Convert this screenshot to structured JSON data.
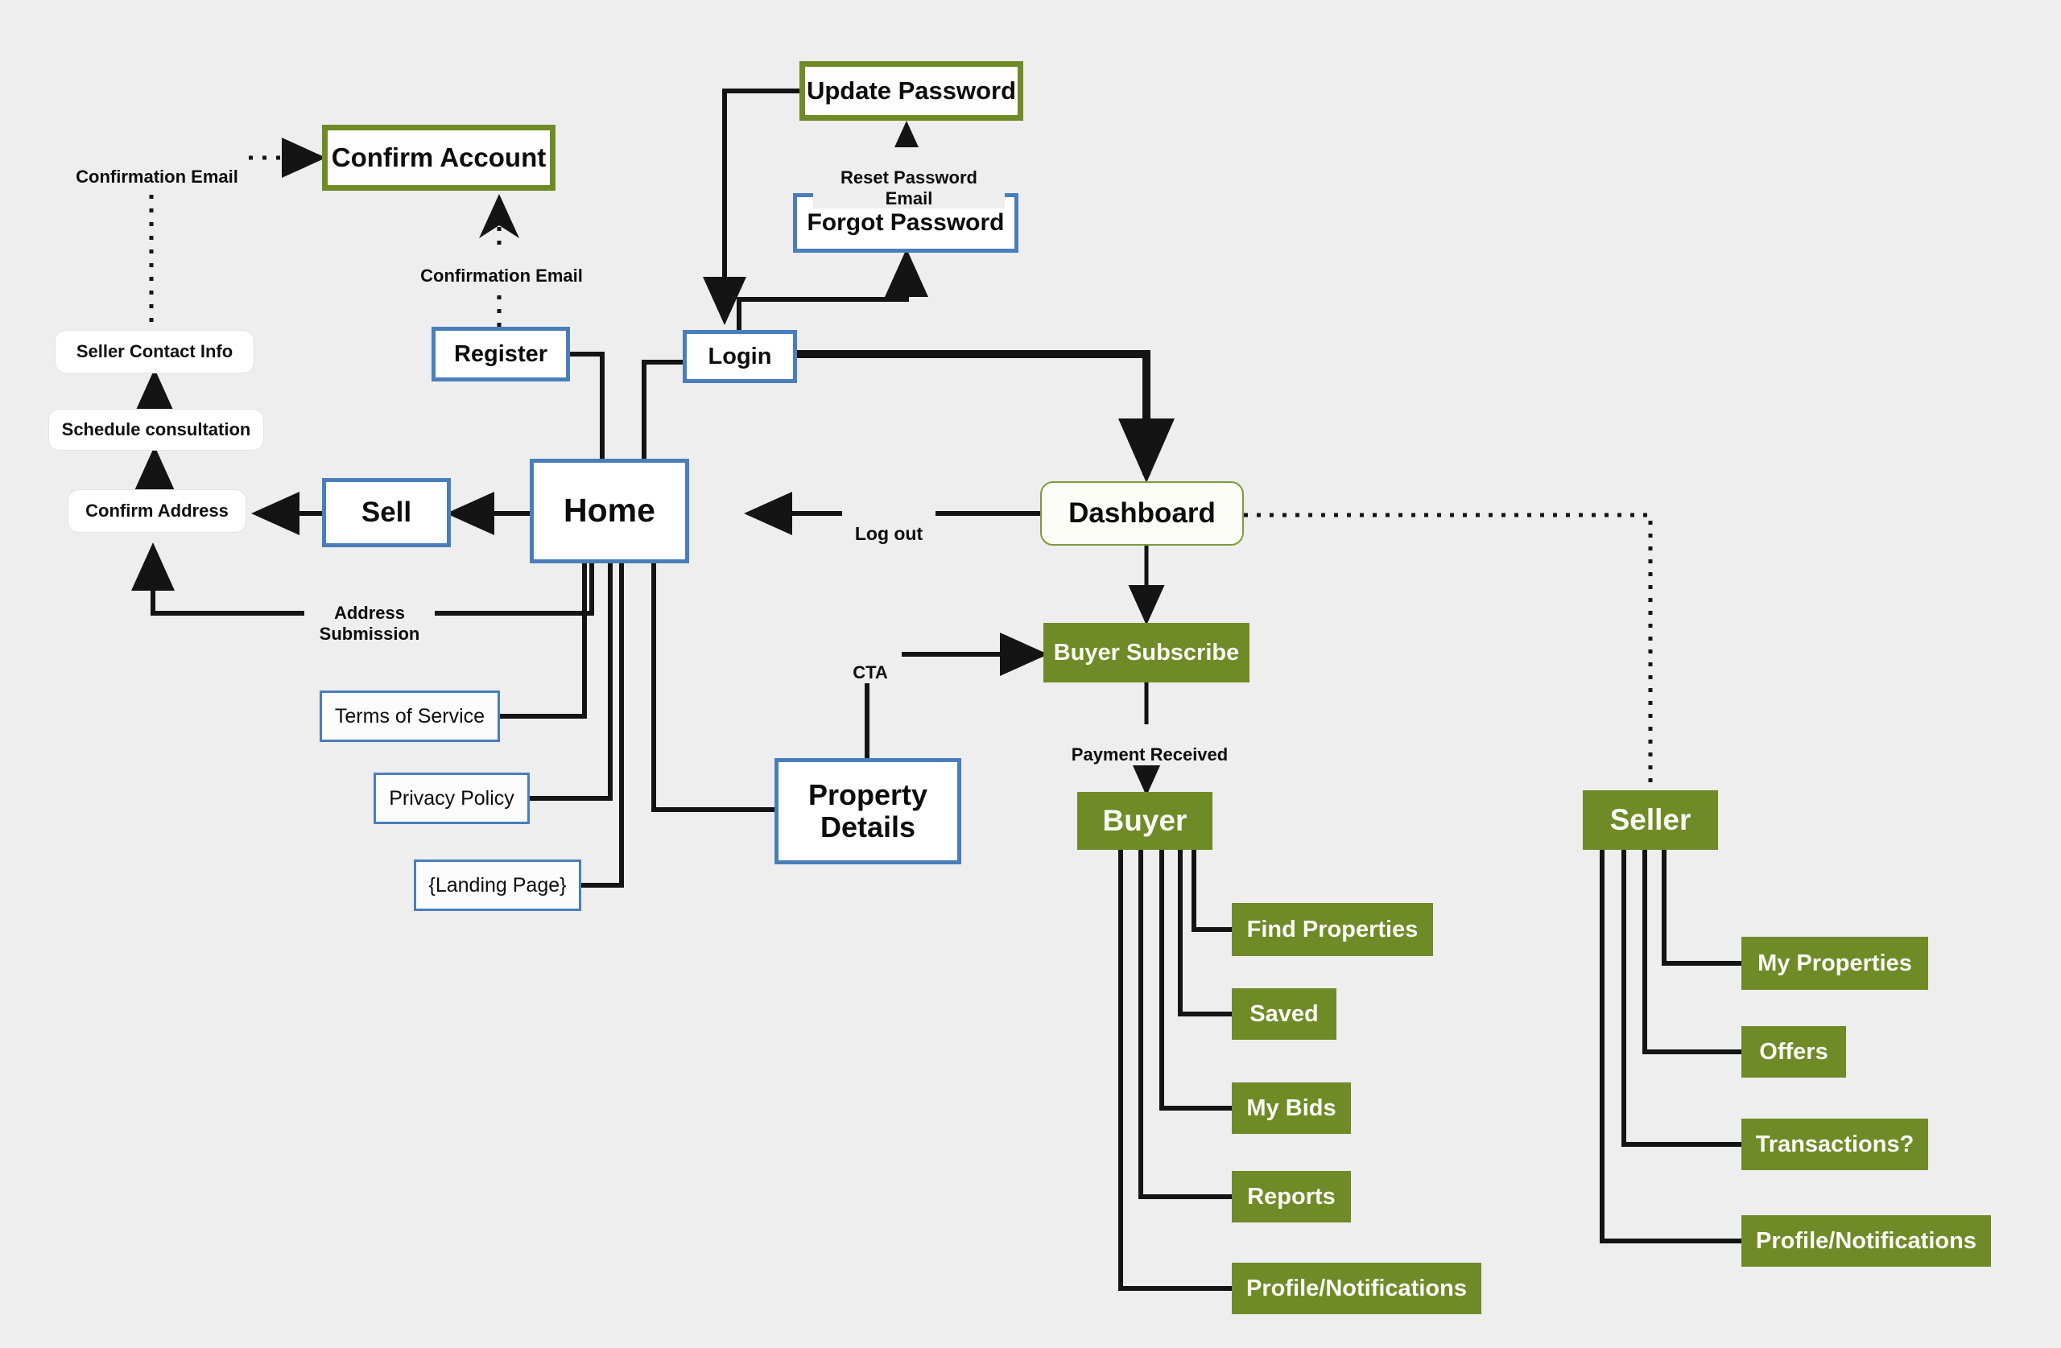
{
  "diagram": {
    "title": "Real estate platform site flow",
    "background_color": "#eeeeee",
    "palette": {
      "blue": "#4a7ebb",
      "green": "#6e8b28",
      "green_border": "#7e9a3e",
      "line": "#141414",
      "white": "#ffffff",
      "text": "#0d0d0d"
    }
  },
  "nodes": {
    "update_password": {
      "label": "Update Password",
      "style": "green-frame"
    },
    "confirm_account": {
      "label": "Confirm Account",
      "style": "green-frame"
    },
    "forgot_password": {
      "label": "Forgot Password",
      "style": "blue"
    },
    "seller_contact_info": {
      "label": "Seller Contact Info",
      "style": "rounded"
    },
    "register": {
      "label": "Register",
      "style": "blue"
    },
    "login": {
      "label": "Login",
      "style": "blue"
    },
    "schedule_consultation": {
      "label": "Schedule consultation",
      "style": "rounded"
    },
    "confirm_address": {
      "label": "Confirm Address",
      "style": "rounded"
    },
    "sell": {
      "label": "Sell",
      "style": "blue"
    },
    "home": {
      "label": "Home",
      "style": "blue"
    },
    "dashboard": {
      "label": "Dashboard",
      "style": "dashboard"
    },
    "buyer_subscribe": {
      "label": "Buyer Subscribe",
      "style": "green-fill"
    },
    "terms_of_service": {
      "label": "Terms of Service",
      "style": "blue-thin"
    },
    "privacy_policy": {
      "label": "Privacy Policy",
      "style": "blue-thin"
    },
    "landing_page": {
      "label": "{Landing Page}",
      "style": "blue-thin"
    },
    "property_details": {
      "label": "Property\nDetails",
      "style": "blue"
    },
    "buyer": {
      "label": "Buyer",
      "style": "green-fill"
    },
    "seller": {
      "label": "Seller",
      "style": "green-fill"
    },
    "find_properties": {
      "label": "Find Properties",
      "style": "green-fill"
    },
    "saved": {
      "label": "Saved",
      "style": "green-fill"
    },
    "my_bids": {
      "label": "My Bids",
      "style": "green-fill"
    },
    "reports": {
      "label": "Reports",
      "style": "green-fill"
    },
    "buyer_profile_notifications": {
      "label": "Profile/Notifications",
      "style": "green-fill"
    },
    "my_properties": {
      "label": "My Properties",
      "style": "green-fill"
    },
    "offers": {
      "label": "Offers",
      "style": "green-fill"
    },
    "transactions": {
      "label": "Transactions?",
      "style": "green-fill"
    },
    "seller_profile_notifications": {
      "label": "Profile/Notifications",
      "style": "green-fill"
    }
  },
  "edge_labels": {
    "confirmation_email_left": "Confirmation Email",
    "confirmation_email_register": "Confirmation Email",
    "reset_password_email": "Reset Password Email",
    "log_out": "Log out",
    "address_submission": "Address\nSubmission",
    "cta": "CTA",
    "payment_received": "Payment Received"
  },
  "edges": [
    {
      "from": "seller_contact_info",
      "to": "confirm_account",
      "kind": "dotted",
      "label": "Confirmation Email"
    },
    {
      "from": "register",
      "to": "confirm_account",
      "kind": "dotted",
      "label": "Confirmation Email"
    },
    {
      "from": "forgot_password",
      "to": "update_password",
      "kind": "dotted",
      "label": "Reset Password Email"
    },
    {
      "from": "update_password",
      "to": "login",
      "kind": "solid"
    },
    {
      "from": "login",
      "to": "forgot_password",
      "kind": "solid"
    },
    {
      "from": "login",
      "to": "dashboard",
      "kind": "solid-thick"
    },
    {
      "from": "home",
      "to": "login",
      "kind": "solid"
    },
    {
      "from": "register",
      "to": "home",
      "kind": "solid"
    },
    {
      "from": "dashboard",
      "to": "home",
      "kind": "solid",
      "label": "Log out"
    },
    {
      "from": "dashboard",
      "to": "buyer_subscribe",
      "kind": "solid"
    },
    {
      "from": "dashboard",
      "to": "seller",
      "kind": "dotted"
    },
    {
      "from": "home",
      "to": "sell",
      "kind": "solid"
    },
    {
      "from": "sell",
      "to": "confirm_address",
      "kind": "solid"
    },
    {
      "from": "home",
      "to": "confirm_address",
      "kind": "solid",
      "label": "Address Submission"
    },
    {
      "from": "confirm_address",
      "to": "schedule_consultation",
      "kind": "solid"
    },
    {
      "from": "schedule_consultation",
      "to": "seller_contact_info",
      "kind": "solid"
    },
    {
      "from": "terms_of_service",
      "to": "home",
      "kind": "solid"
    },
    {
      "from": "privacy_policy",
      "to": "home",
      "kind": "solid"
    },
    {
      "from": "landing_page",
      "to": "home",
      "kind": "solid"
    },
    {
      "from": "home",
      "to": "property_details",
      "kind": "solid"
    },
    {
      "from": "property_details",
      "to": "buyer_subscribe",
      "kind": "solid",
      "label": "CTA"
    },
    {
      "from": "buyer_subscribe",
      "to": "buyer",
      "kind": "solid",
      "label": "Payment Received"
    },
    {
      "from": "buyer",
      "to": "find_properties",
      "kind": "solid"
    },
    {
      "from": "buyer",
      "to": "saved",
      "kind": "solid"
    },
    {
      "from": "buyer",
      "to": "my_bids",
      "kind": "solid"
    },
    {
      "from": "buyer",
      "to": "reports",
      "kind": "solid"
    },
    {
      "from": "buyer",
      "to": "buyer_profile_notifications",
      "kind": "solid"
    },
    {
      "from": "seller",
      "to": "my_properties",
      "kind": "solid"
    },
    {
      "from": "seller",
      "to": "offers",
      "kind": "solid"
    },
    {
      "from": "seller",
      "to": "transactions",
      "kind": "solid"
    },
    {
      "from": "seller",
      "to": "seller_profile_notifications",
      "kind": "solid"
    }
  ]
}
